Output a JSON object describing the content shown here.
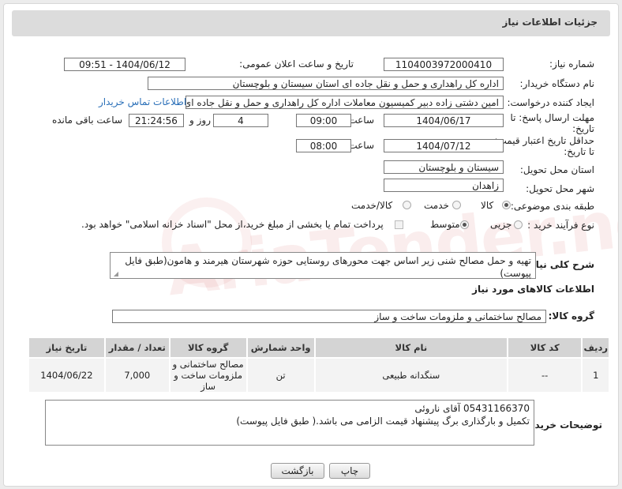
{
  "header": {
    "title": "جزئیات اطلاعات نیاز"
  },
  "form": {
    "need_number_label": "شماره نیاز:",
    "need_number": "1104003972000410",
    "announce_label": "تاریخ و ساعت اعلان عمومی:",
    "announce_value": "1404/06/12 - 09:51",
    "buyer_org_label": "نام دستگاه خریدار:",
    "buyer_org": "اداره کل راهداری و حمل و نقل جاده ای استان سیستان و بلوچستان",
    "requester_label": "ایجاد کننده درخواست:",
    "requester": "امین دشتی زاده دبیر کمیسیون معاملات اداره کل راهداری و حمل و نقل جاده ای",
    "contact_link": "اطلاعات تماس خریدار",
    "deadline_label_1": "مهلت ارسال پاسخ: تا",
    "deadline_label_2": "تاریخ:",
    "deadline_date": "1404/06/17",
    "time_label": "ساعت",
    "deadline_time": "09:00",
    "days_value": "4",
    "days_label": "روز و",
    "remaining_time": "21:24:56",
    "remaining_label": "ساعت باقی مانده",
    "validity_label_1": "حداقل تاریخ اعتبار قیمت:",
    "validity_label_2": "تا تاریخ:",
    "validity_date": "1404/07/12",
    "validity_time_label": "ساعت",
    "validity_time": "08:00",
    "province_label": "استان محل تحویل:",
    "province": "سیستان و بلوچستان",
    "city_label": "شهر محل تحویل:",
    "city": "زاهدان",
    "category_label": "طبقه بندی موضوعی:",
    "category_options": [
      "کالا",
      "خدمت",
      "کالا/خدمت"
    ],
    "purchase_type_label": "نوع فرآیند خرید :",
    "purchase_options": [
      "جزیی",
      "متوسط"
    ],
    "payment_note": "پرداخت تمام یا بخشی از مبلغ خرید،از محل \"اسناد خزانه اسلامی\" خواهد بود.",
    "summary_label": "شرح کلی نیاز:",
    "summary_text": "تهیه و حمل مصالح شنی زیر اساس جهت محورهای روستایی حوزه شهرستان هیرمند و هامون(طبق فایل پیوست)",
    "goods_info_title": "اطلاعات کالاهای مورد نیاز",
    "goods_group_label": "گروه کالا:",
    "goods_group": "مصالح ساختمانی و ملزومات ساخت و ساز",
    "buyer_notes_label": "توضیحات خریدار:",
    "buyer_notes_line1": "05431166370 آقای ناروئی",
    "buyer_notes_line2": "تکمیل و بارگذاری برگ پیشنهاد قیمت الزامی می باشد.( طبق فایل پیوست)"
  },
  "table": {
    "headers": [
      "ردیف",
      "کد کالا",
      "نام کالا",
      "واحد شمارش",
      "گروه کالا",
      "تعداد / مقدار",
      "تاریخ نیاز"
    ],
    "rows": [
      [
        "1",
        "--",
        "سنگدانه طبیعی",
        "تن",
        "مصالح ساختمانی و ملزومات ساخت و ساز",
        "7,000",
        "1404/06/22"
      ]
    ]
  },
  "buttons": {
    "print": "چاپ",
    "back": "بازگشت"
  },
  "watermark": "AriaTender.neT",
  "colors": {
    "header_bg": "#dcdcdc",
    "link": "#2a6fb8",
    "table_header": "#d4d4d4"
  }
}
